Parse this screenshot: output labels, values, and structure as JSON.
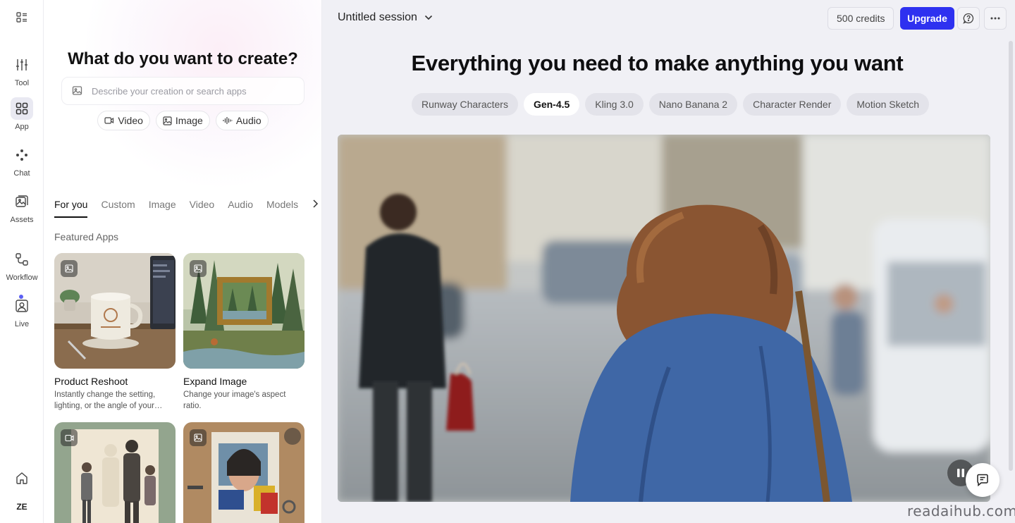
{
  "rail": {
    "items": [
      {
        "label": "Tool",
        "icon": "sliders-icon"
      },
      {
        "label": "App",
        "icon": "grid-icon"
      },
      {
        "label": "Chat",
        "icon": "chat-dots-icon"
      },
      {
        "label": "Assets",
        "icon": "assets-icon"
      },
      {
        "label": "Workflow",
        "icon": "workflow-icon"
      },
      {
        "label": "Live",
        "icon": "live-icon"
      }
    ],
    "user_initials": "ZE"
  },
  "panel": {
    "title": "What do you want to create?",
    "search_placeholder": "Describe your creation or search apps",
    "chips": [
      "Video",
      "Image",
      "Audio"
    ],
    "tabs": [
      "For you",
      "Custom",
      "Image",
      "Video",
      "Audio",
      "Models"
    ],
    "featured_title": "Featured Apps",
    "cards": [
      {
        "title": "Product Reshoot",
        "desc": "Instantly change the setting, lighting, or the angle of your…",
        "badge": "image-icon"
      },
      {
        "title": "Expand Image",
        "desc": "Change your image's aspect ratio.",
        "badge": "image-icon"
      },
      {
        "title": "",
        "desc": "",
        "badge": "video-icon"
      },
      {
        "title": "",
        "desc": "",
        "badge": "image-icon"
      }
    ]
  },
  "main": {
    "session_title": "Untitled session",
    "credits": "500 credits",
    "upgrade": "Upgrade",
    "headline": "Everything you need to make anything you want",
    "models": [
      "Runway Characters",
      "Gen-4.5",
      "Kling 3.0",
      "Nano Banana 2",
      "Character Render",
      "Motion Sketch"
    ],
    "active_model": "Gen-4.5"
  },
  "watermark": "readaihub.com",
  "colors": {
    "accent": "#2e31f0",
    "rail_dot": "#5b5ff3",
    "main_bg": "#f0f0f5"
  }
}
